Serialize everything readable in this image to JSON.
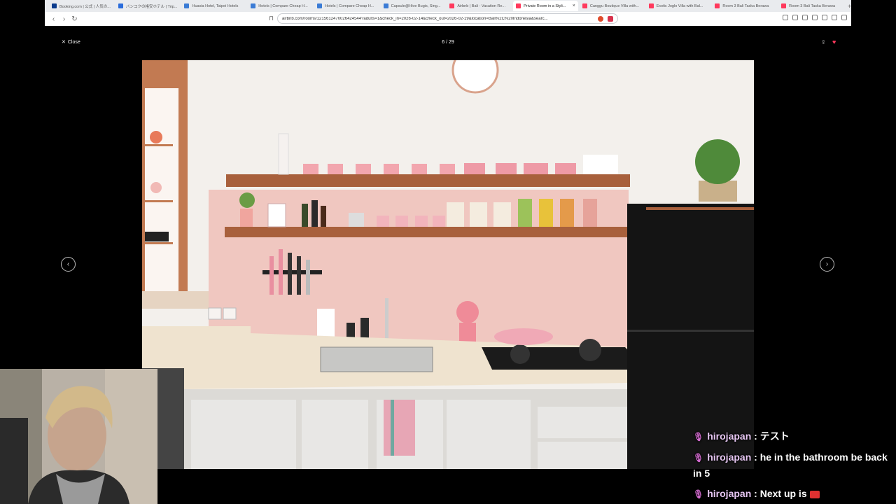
{
  "browser": {
    "tabs": [
      {
        "label": "Booking.com | 公式 | 人気の...",
        "favicon_color": "#0b3b8c",
        "active": false
      },
      {
        "label": "バンコクの格安ホテル | Trip...",
        "favicon_color": "#2a6cdb",
        "active": false
      },
      {
        "label": "Huaxia Hotel, Taipei Hotels",
        "favicon_color": "#3a7bd5",
        "active": false
      },
      {
        "label": "Hotels | Compare Cheap H...",
        "favicon_color": "#3a7bd5",
        "active": false
      },
      {
        "label": "Hotels | Compare Cheap H...",
        "favicon_color": "#3a7bd5",
        "active": false
      },
      {
        "label": "Capsule@Hive Bugis, Sing...",
        "favicon_color": "#3a7bd5",
        "active": false
      },
      {
        "label": "Airbnb | Bali - Vacation Re...",
        "favicon_color": "#ff385c",
        "active": false
      },
      {
        "label": "Private Room in a Styli...",
        "favicon_color": "#ff385c",
        "active": true
      },
      {
        "label": "Canggu Boutique Villa with...",
        "favicon_color": "#ff385c",
        "active": false
      },
      {
        "label": "Exotic Joglo Villa with Bal...",
        "favicon_color": "#ff385c",
        "active": false
      },
      {
        "label": "Room 3 Bali Taska Berawa",
        "favicon_color": "#ff385c",
        "active": false
      },
      {
        "label": "Room 3 Bali Taska Berawa",
        "favicon_color": "#ff385c",
        "active": false
      }
    ],
    "new_tab": "+",
    "active_tab_close": "×",
    "url": "airbnb.com/rooms/1215612470026424544?adults=1&check_in=2026-02-14&check_out=2026-02-19&location=Bali%2C%20Indonesia&searc..."
  },
  "gallery": {
    "close_label": "Close",
    "counter": "6 / 29",
    "prev": "‹",
    "next": "›"
  },
  "chat": {
    "messages": [
      {
        "user": "hirojapan",
        "text": "テスト"
      },
      {
        "user": "hirojapan",
        "text": "he in the bathroom be back in 5"
      },
      {
        "user": "hirojapan",
        "text": "Next up is"
      }
    ]
  },
  "colors": {
    "accent": "#ff385c",
    "chat_user": "#e6c6f2"
  }
}
